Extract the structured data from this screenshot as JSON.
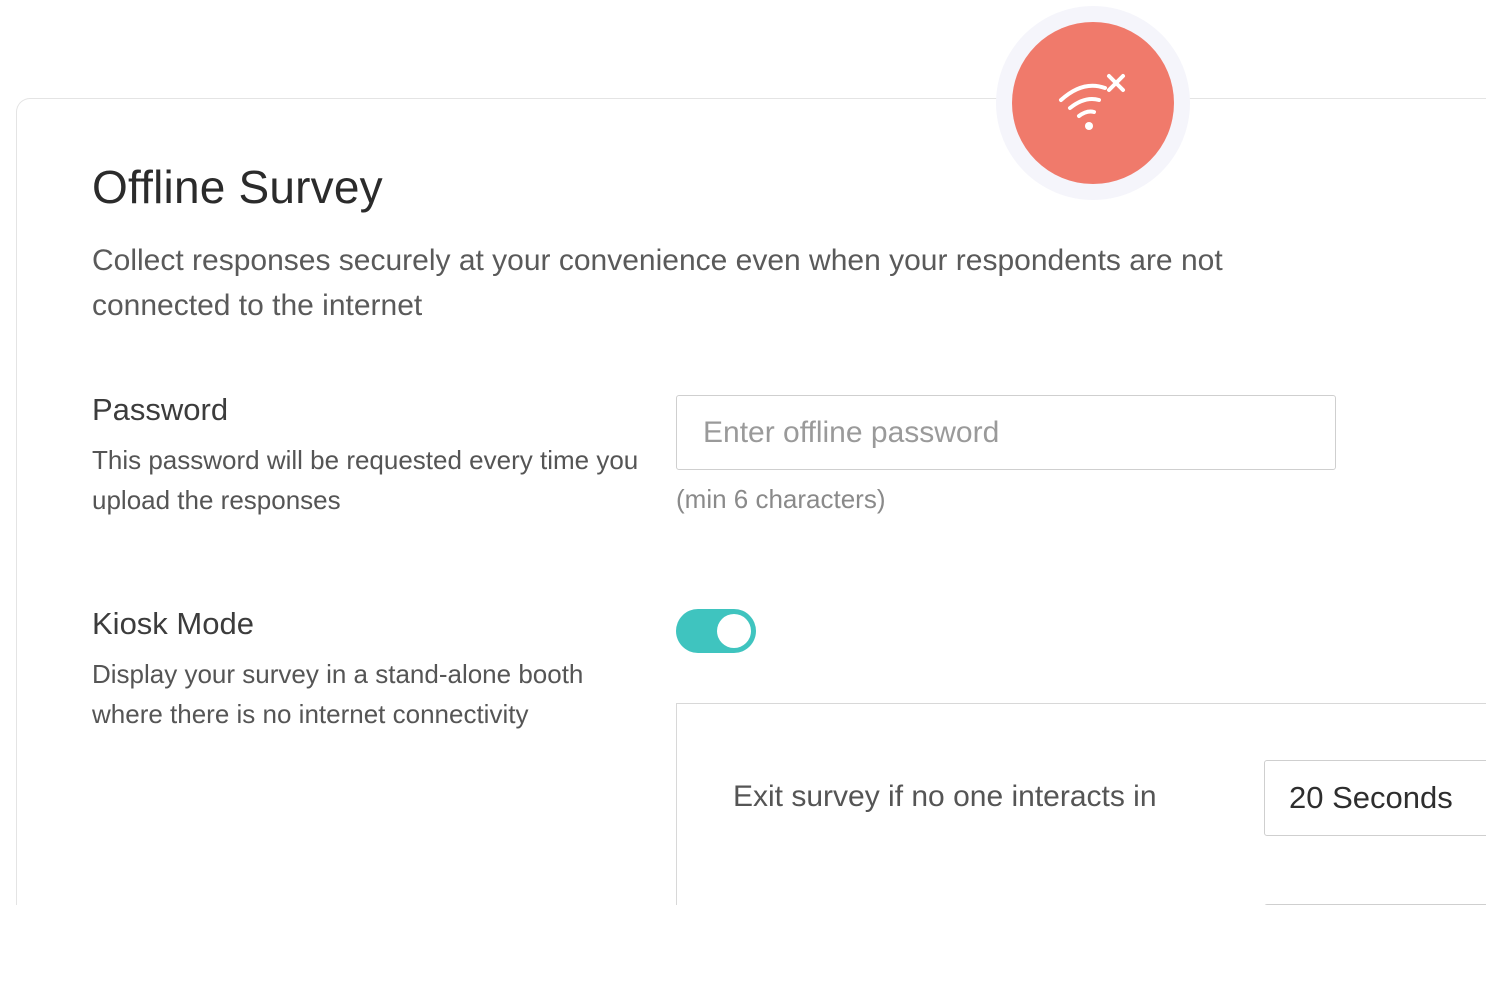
{
  "header": {
    "title": "Offline Survey",
    "subtitle": "Collect responses securely at your convenience even when your respondents are not connected to the internet",
    "badge_icon": "wifi-off-icon"
  },
  "password": {
    "label": "Password",
    "description": "This password will be requested every time you upload the responses",
    "placeholder": "Enter offline password",
    "value": "",
    "hint": "(min 6 characters)"
  },
  "kiosk": {
    "label": "Kiosk Mode",
    "description": "Display your survey in a stand-alone booth where there is no internet connectivity",
    "enabled": true,
    "exit_label": "Exit survey if no one interacts in",
    "exit_value": "20 Seconds"
  },
  "colors": {
    "badge": "#f07a6b",
    "badge_halo": "#f5f5fb",
    "toggle_on": "#3fc4bf"
  }
}
